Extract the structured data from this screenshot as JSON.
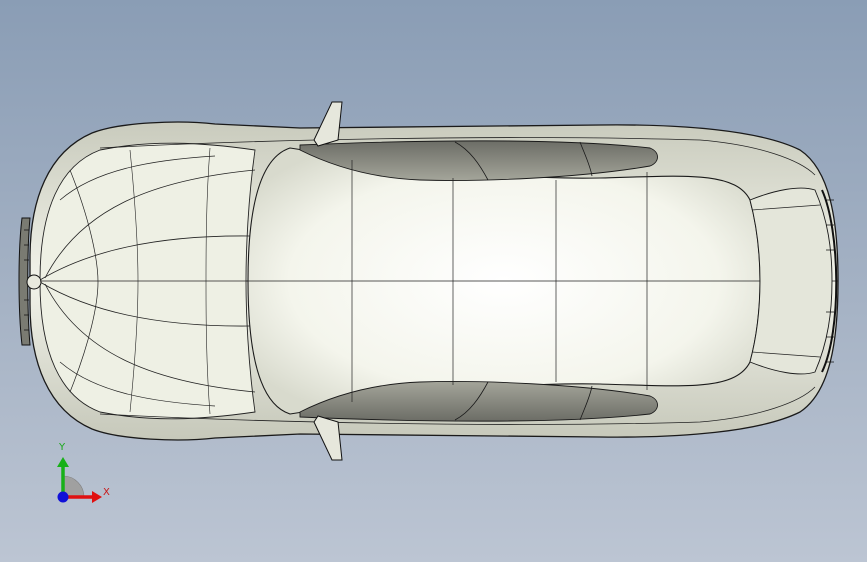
{
  "viewport": {
    "model": "sedan-car-body",
    "view": "top",
    "background_top": "#8a9db5",
    "background_bottom": "#bcc5d3"
  },
  "triad": {
    "x_label": "X",
    "y_label": "Y",
    "x_color": "#e01010",
    "y_color": "#18b018",
    "z_color": "#1010d8",
    "label_color_x": "#c81818",
    "label_color_y": "#18a818"
  }
}
